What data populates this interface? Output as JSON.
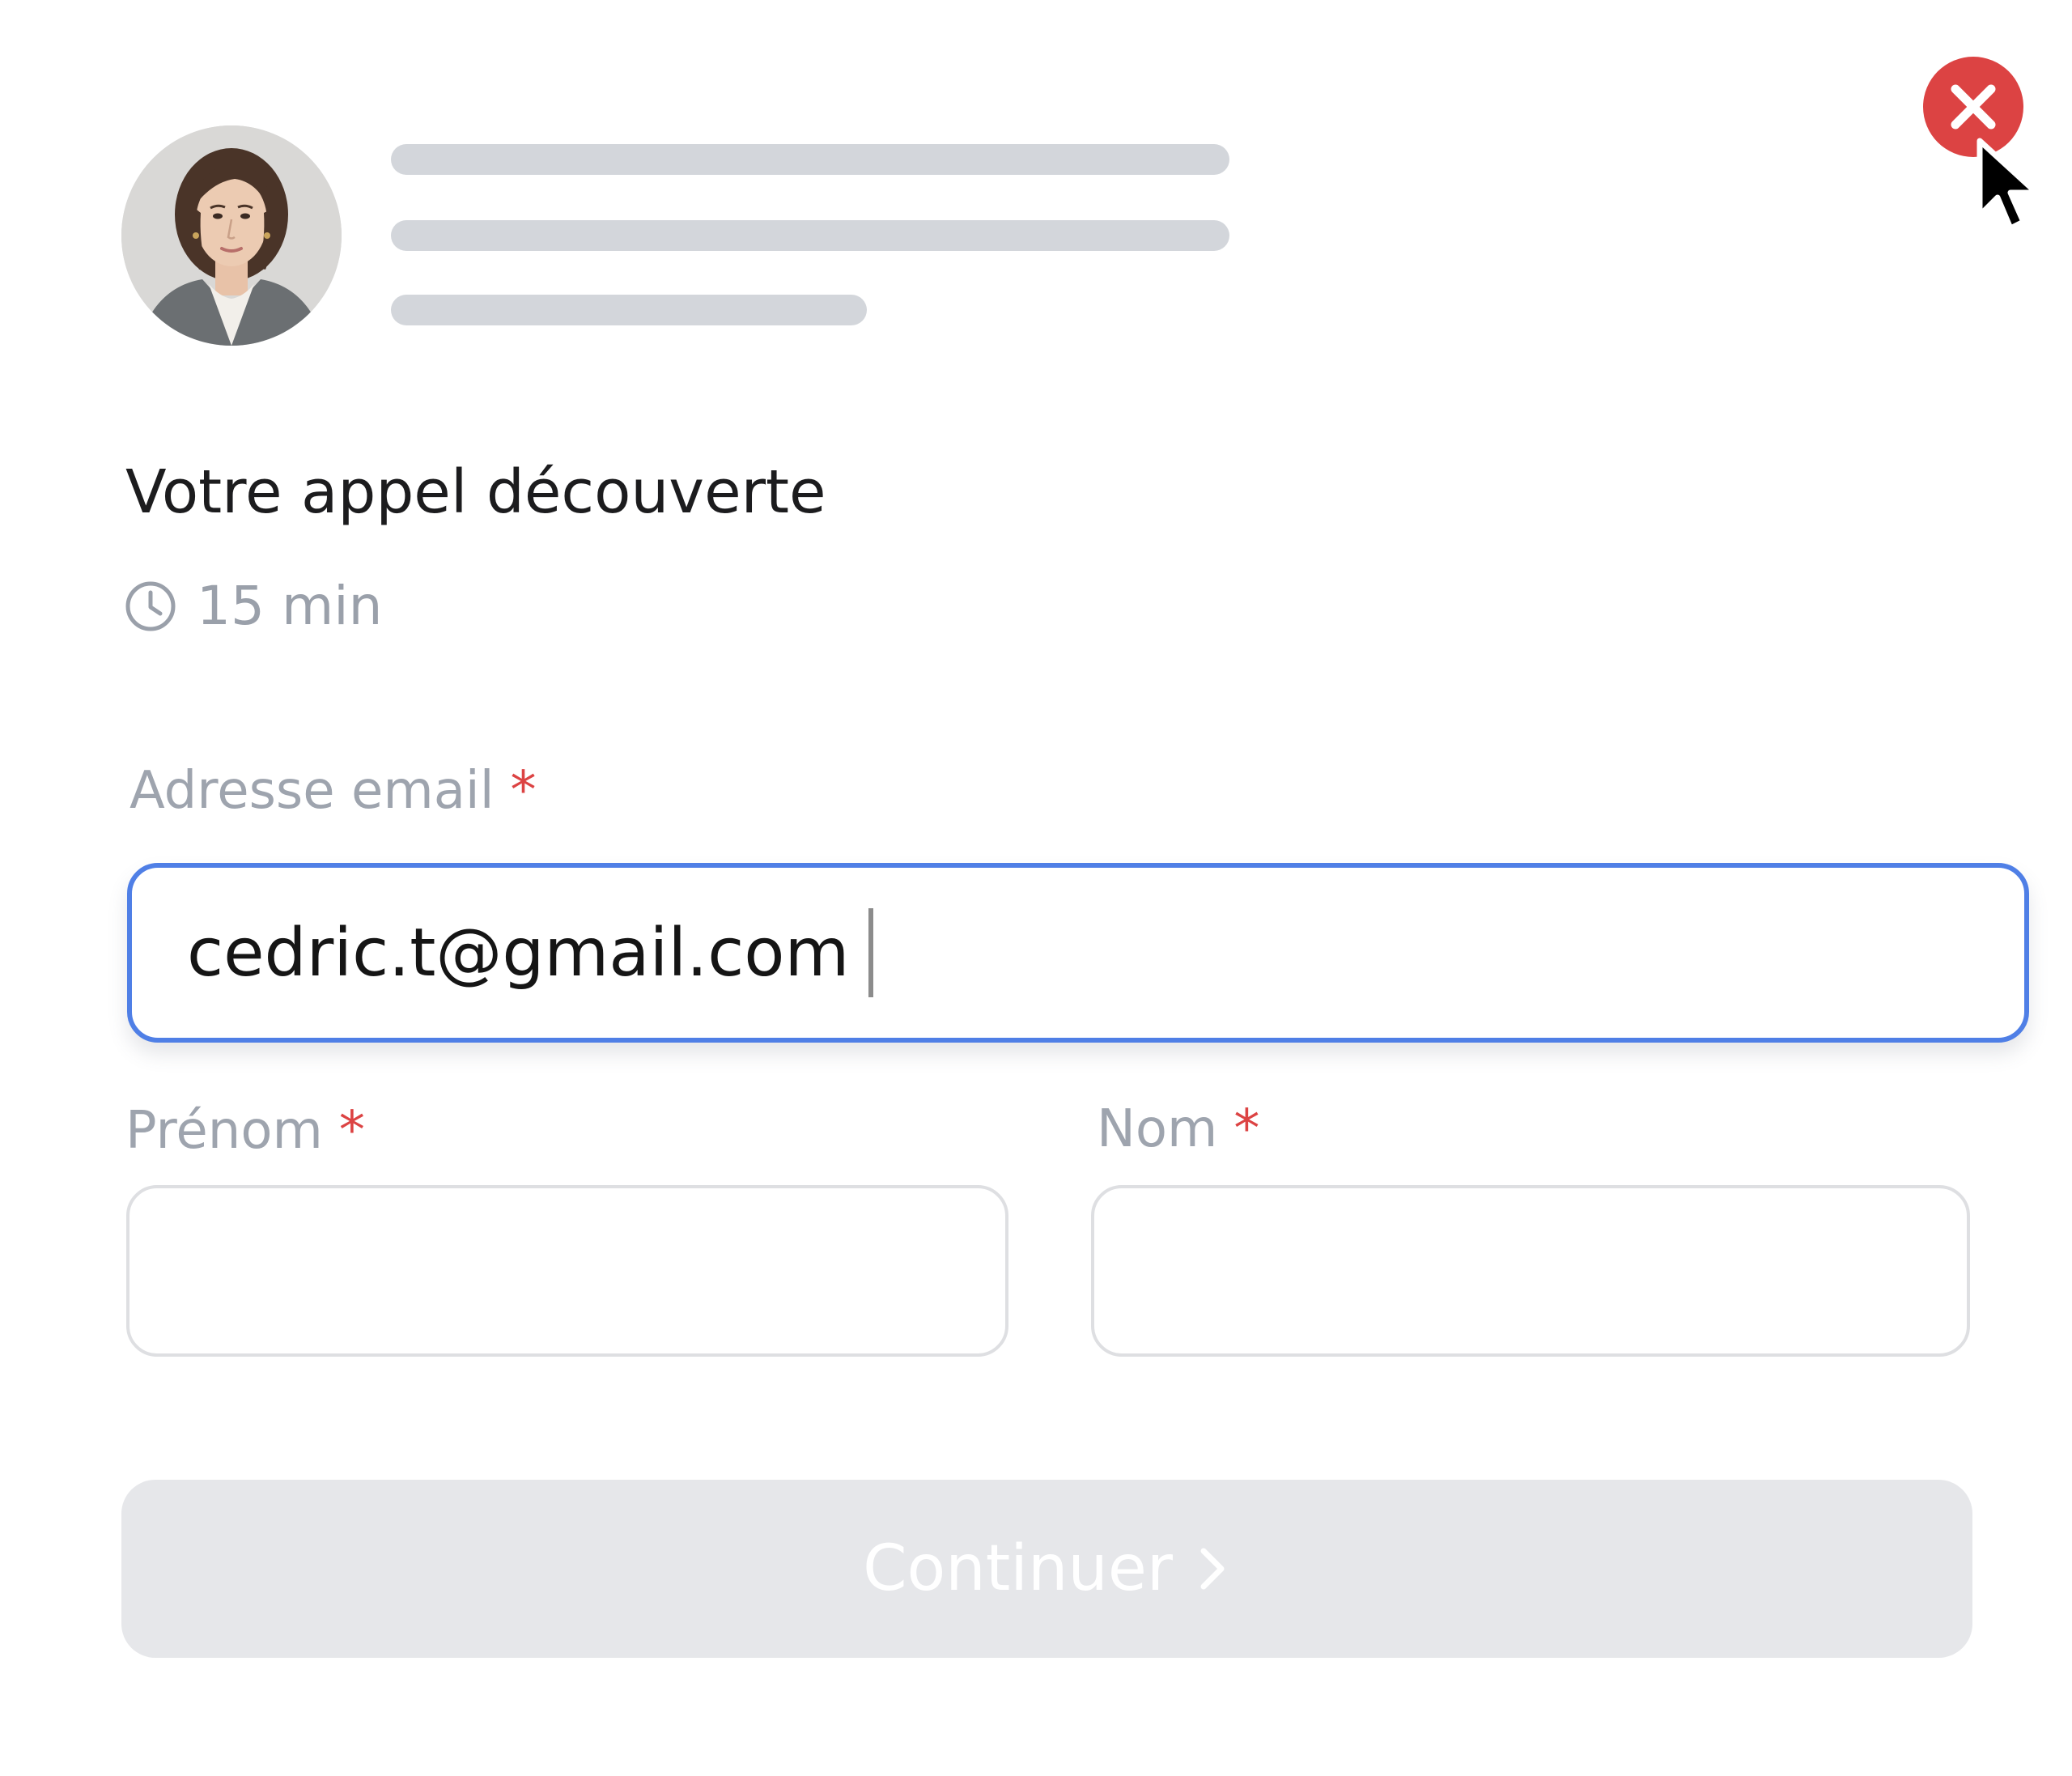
{
  "header": {
    "avatar_alt": "Photo de profil"
  },
  "event": {
    "title": "Votre appel découverte",
    "duration": "15 min"
  },
  "form": {
    "email": {
      "label": "Adresse email",
      "required_mark": "*",
      "value": "cedric.t@gmail.com"
    },
    "first_name": {
      "label": "Prénom",
      "required_mark": "*",
      "value": ""
    },
    "last_name": {
      "label": "Nom",
      "required_mark": "*",
      "value": ""
    }
  },
  "actions": {
    "continue_label": "Continuer",
    "continue_icon": "chevron-right-icon",
    "close_icon": "close-icon"
  },
  "colors": {
    "close_button": "#dc4343",
    "input_focus_border": "#4f7fe6",
    "required_star": "#dc4343",
    "skeleton": "#d3d6db",
    "disabled_button": "#e6e7ea",
    "label_text": "#9ea4ae"
  }
}
